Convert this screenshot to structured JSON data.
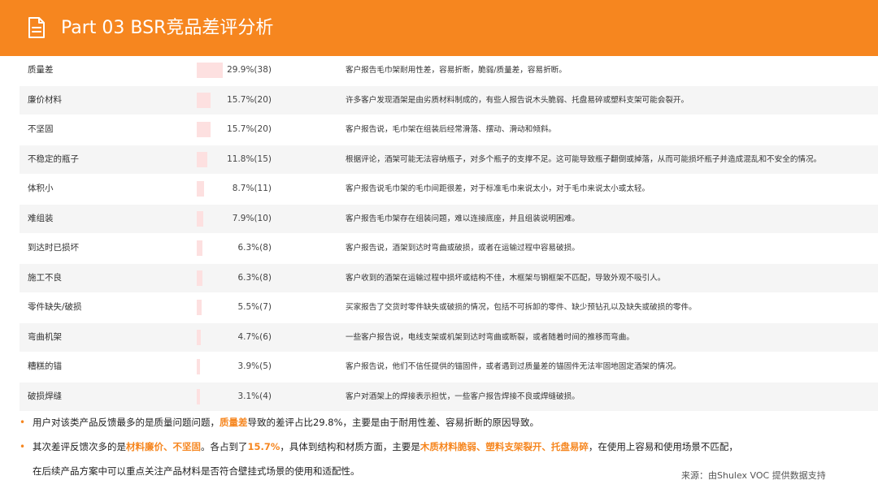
{
  "header": {
    "title": "Part 03  BSR竞品差评分析",
    "icon": "document-icon",
    "bg_color": "#f6861f"
  },
  "table": {
    "rows": [
      {
        "name": "质量差",
        "pct": "29.9%(38)",
        "value": 29.9,
        "desc": "客户报告毛巾架耐用性差，容易折断，脆弱/质量差，容易折断。"
      },
      {
        "name": "廉价材料",
        "pct": "15.7%(20)",
        "value": 15.7,
        "desc": "许多客户发现酒架是由劣质材料制成的，有些人报告说木头脆弱、托盘易碎或塑料支架可能会裂开。"
      },
      {
        "name": "不坚固",
        "pct": "15.7%(20)",
        "value": 15.7,
        "desc": "客户报告说，毛巾架在组装后经常滑落、摆动、滑动和倾斜。"
      },
      {
        "name": "不稳定的瓶子",
        "pct": "11.8%(15)",
        "value": 11.8,
        "desc": "根据评论，酒架可能无法容纳瓶子，对多个瓶子的支撑不足。这可能导致瓶子翻倒或掉落，从而可能损坏瓶子并造成混乱和不安全的情况。"
      },
      {
        "name": "体积小",
        "pct": "8.7%(11)",
        "value": 8.7,
        "desc": "客户报告说毛巾架的毛巾间距很差，对于标准毛巾来说太小，对于毛巾来说太小或太轻。"
      },
      {
        "name": "难组装",
        "pct": "7.9%(10)",
        "value": 7.9,
        "desc": "客户报告毛巾架存在组装问题，难以连接底座，并且组装说明困难。"
      },
      {
        "name": "到达时已损坏",
        "pct": "6.3%(8)",
        "value": 6.3,
        "desc": "客户报告说，酒架到达时弯曲或破损，或者在运输过程中容易破损。"
      },
      {
        "name": "施工不良",
        "pct": "6.3%(8)",
        "value": 6.3,
        "desc": "客户收到的酒架在运输过程中损坏或结构不佳，木框架与钢框架不匹配，导致外观不吸引人。"
      },
      {
        "name": "零件缺失/破损",
        "pct": "5.5%(7)",
        "value": 5.5,
        "desc": "买家报告了交货时零件缺失或破损的情况，包括不可拆卸的零件、缺少预钻孔以及缺失或破损的零件。"
      },
      {
        "name": "弯曲机架",
        "pct": "4.7%(6)",
        "value": 4.7,
        "desc": "一些客户报告说，电线支架或机架到达时弯曲或断裂，或者随着时间的推移而弯曲。"
      },
      {
        "name": "糟糕的锚",
        "pct": "3.9%(5)",
        "value": 3.9,
        "desc": "客户报告说，他们不信任提供的锚固件，或者遇到过质量差的锚固件无法牢固地固定酒架的情况。"
      },
      {
        "name": "破损焊缝",
        "pct": "3.1%(4)",
        "value": 3.1,
        "desc": "客户对酒架上的焊接表示担忧，一些客户报告焊接不良或焊缝破损。"
      }
    ]
  },
  "summary": {
    "line1": {
      "a": "用户对该类产品反馈最多的是质量问题问题，",
      "hl": "质量差",
      "b": "导致的差评占比29.8%，主要是由于耐用性差、容易折断的原因导致。"
    },
    "line2": {
      "a": "其次差评反馈次多的是",
      "hl1": "材料廉价、不坚固",
      "b": "。各占到了",
      "hl2": "15.7%",
      "c": "，具体到结构和材质方面，主要是",
      "hl3": "木质材料脆弱、塑料支架裂开、托盘易碎",
      "d": "，在使用上容易和使用场景不匹配，"
    },
    "line3": "在后续产品方案中可以重点关注产品材料是否符合壁挂式场景的使用和适配性。"
  },
  "source": "来源：由Shulex VOC 提供数据支持"
}
